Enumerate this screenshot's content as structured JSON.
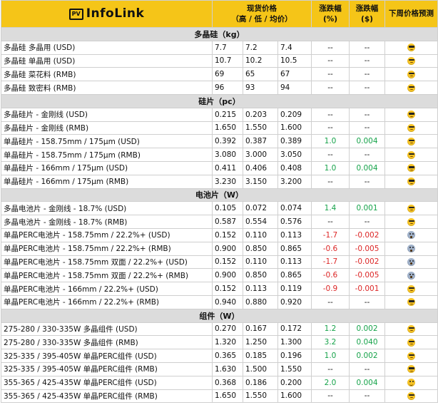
{
  "header": {
    "logo_box": "PV",
    "logo_text": "InfoLink",
    "spot_price": "现货价格",
    "spot_sub": "（高 / 低 / 均价）",
    "change_pct": "涨跌幅",
    "change_pct_unit": "(%)",
    "change_usd": "涨跌幅",
    "change_usd_unit": "($)",
    "forecast": "下周价格预测"
  },
  "sections": [
    {
      "title": "多晶硅（kg）",
      "rows": [
        {
          "name": "多晶硅 多晶用 (USD)",
          "high": "7.7",
          "low": "7.2",
          "avg": "7.4",
          "pct": "--",
          "pct_dir": "",
          "usd": "--",
          "usd_dir": "",
          "forecast": "cool"
        },
        {
          "name": "多晶硅 单晶用 (USD)",
          "high": "10.7",
          "low": "10.2",
          "avg": "10.5",
          "pct": "--",
          "pct_dir": "",
          "usd": "--",
          "usd_dir": "",
          "forecast": "cool"
        },
        {
          "name": "多晶硅 菜花料 (RMB)",
          "high": "69",
          "low": "65",
          "avg": "67",
          "pct": "--",
          "pct_dir": "",
          "usd": "--",
          "usd_dir": "",
          "forecast": "cool"
        },
        {
          "name": "多晶硅 致密料 (RMB)",
          "high": "96",
          "low": "93",
          "avg": "94",
          "pct": "--",
          "pct_dir": "",
          "usd": "--",
          "usd_dir": "",
          "forecast": "cool"
        }
      ]
    },
    {
      "title": "硅片（pc）",
      "rows": [
        {
          "name": "多晶硅片 - 金刚线 (USD)",
          "high": "0.215",
          "low": "0.203",
          "avg": "0.209",
          "pct": "--",
          "pct_dir": "",
          "usd": "--",
          "usd_dir": "",
          "forecast": "cool"
        },
        {
          "name": "多晶硅片 - 金刚线 (RMB)",
          "high": "1.650",
          "low": "1.550",
          "avg": "1.600",
          "pct": "--",
          "pct_dir": "",
          "usd": "--",
          "usd_dir": "",
          "forecast": "cool"
        },
        {
          "name": "单晶硅片 - 158.75mm / 175μm (USD)",
          "high": "0.392",
          "low": "0.387",
          "avg": "0.389",
          "pct": "1.0",
          "pct_dir": "up",
          "usd": "0.004",
          "usd_dir": "up",
          "forecast": "cool"
        },
        {
          "name": "单晶硅片 - 158.75mm / 175μm (RMB)",
          "high": "3.080",
          "low": "3.000",
          "avg": "3.050",
          "pct": "--",
          "pct_dir": "",
          "usd": "--",
          "usd_dir": "",
          "forecast": "cool"
        },
        {
          "name": "单晶硅片 - 166mm / 175μm (USD)",
          "high": "0.411",
          "low": "0.406",
          "avg": "0.408",
          "pct": "1.0",
          "pct_dir": "up",
          "usd": "0.004",
          "usd_dir": "up",
          "forecast": "cool"
        },
        {
          "name": "单晶硅片 - 166mm / 175μm (RMB)",
          "high": "3.230",
          "low": "3.150",
          "avg": "3.200",
          "pct": "--",
          "pct_dir": "",
          "usd": "--",
          "usd_dir": "",
          "forecast": "cool"
        }
      ]
    },
    {
      "title": "电池片（W）",
      "rows": [
        {
          "name": "多晶电池片 - 金刚线 - 18.7% (USD)",
          "high": "0.105",
          "low": "0.072",
          "avg": "0.074",
          "pct": "1.4",
          "pct_dir": "up",
          "usd": "0.001",
          "usd_dir": "up",
          "forecast": "cool"
        },
        {
          "name": "多晶电池片 - 金刚线 - 18.7% (RMB)",
          "high": "0.587",
          "low": "0.554",
          "avg": "0.576",
          "pct": "--",
          "pct_dir": "",
          "usd": "--",
          "usd_dir": "",
          "forecast": "cool"
        },
        {
          "name": "单晶PERC电池片 - 158.75mm / 22.2%+ (USD)",
          "high": "0.152",
          "low": "0.110",
          "avg": "0.113",
          "pct": "-1.7",
          "pct_dir": "down",
          "usd": "-0.002",
          "usd_dir": "down",
          "forecast": "shock"
        },
        {
          "name": "单晶PERC电池片 - 158.75mm / 22.2%+ (RMB)",
          "high": "0.900",
          "low": "0.850",
          "avg": "0.865",
          "pct": "-0.6",
          "pct_dir": "down",
          "usd": "-0.005",
          "usd_dir": "down",
          "forecast": "shock"
        },
        {
          "name": "单晶PERC电池片 - 158.75mm 双面 / 22.2%+ (USD)",
          "high": "0.152",
          "low": "0.110",
          "avg": "0.113",
          "pct": "-1.7",
          "pct_dir": "down",
          "usd": "-0.002",
          "usd_dir": "down",
          "forecast": "shock"
        },
        {
          "name": "单晶PERC电池片 - 158.75mm 双面 / 22.2%+ (RMB)",
          "high": "0.900",
          "low": "0.850",
          "avg": "0.865",
          "pct": "-0.6",
          "pct_dir": "down",
          "usd": "-0.005",
          "usd_dir": "down",
          "forecast": "shock"
        },
        {
          "name": "单晶PERC电池片 - 166mm / 22.2%+ (USD)",
          "high": "0.152",
          "low": "0.113",
          "avg": "0.119",
          "pct": "-0.9",
          "pct_dir": "down",
          "usd": "-0.001",
          "usd_dir": "down",
          "forecast": "cool"
        },
        {
          "name": "单晶PERC电池片 - 166mm / 22.2%+ (RMB)",
          "high": "0.940",
          "low": "0.880",
          "avg": "0.920",
          "pct": "--",
          "pct_dir": "",
          "usd": "--",
          "usd_dir": "",
          "forecast": "cool"
        }
      ]
    },
    {
      "title": "组件（W）",
      "rows": [
        {
          "name": "275-280 / 330-335W 多晶组件 (USD)",
          "high": "0.270",
          "low": "0.167",
          "avg": "0.172",
          "pct": "1.2",
          "pct_dir": "up",
          "usd": "0.002",
          "usd_dir": "up",
          "forecast": "cool"
        },
        {
          "name": "275-280 / 330-335W 多晶组件 (RMB)",
          "high": "1.320",
          "low": "1.250",
          "avg": "1.300",
          "pct": "3.2",
          "pct_dir": "up",
          "usd": "0.040",
          "usd_dir": "up",
          "forecast": "cool"
        },
        {
          "name": "325-335 / 395-405W 单晶PERC组件 (USD)",
          "high": "0.365",
          "low": "0.185",
          "avg": "0.196",
          "pct": "1.0",
          "pct_dir": "up",
          "usd": "0.002",
          "usd_dir": "up",
          "forecast": "cool"
        },
        {
          "name": "325-335 / 395-405W 单晶PERC组件 (RMB)",
          "high": "1.630",
          "low": "1.500",
          "avg": "1.550",
          "pct": "--",
          "pct_dir": "",
          "usd": "--",
          "usd_dir": "",
          "forecast": "cool"
        },
        {
          "name": "355-365 / 425-435W 单晶PERC组件 (USD)",
          "high": "0.368",
          "low": "0.186",
          "avg": "0.200",
          "pct": "2.0",
          "pct_dir": "up",
          "usd": "0.004",
          "usd_dir": "up",
          "forecast": "happy"
        },
        {
          "name": "355-365 / 425-435W 单晶PERC组件 (RMB)",
          "high": "1.650",
          "low": "1.550",
          "avg": "1.600",
          "pct": "--",
          "pct_dir": "",
          "usd": "--",
          "usd_dir": "",
          "forecast": "cool"
        }
      ]
    }
  ],
  "colors": {
    "header_bg": "#f5c518",
    "section_bg": "#dcdcdc",
    "up": "#16a34a",
    "down": "#dc2626"
  }
}
